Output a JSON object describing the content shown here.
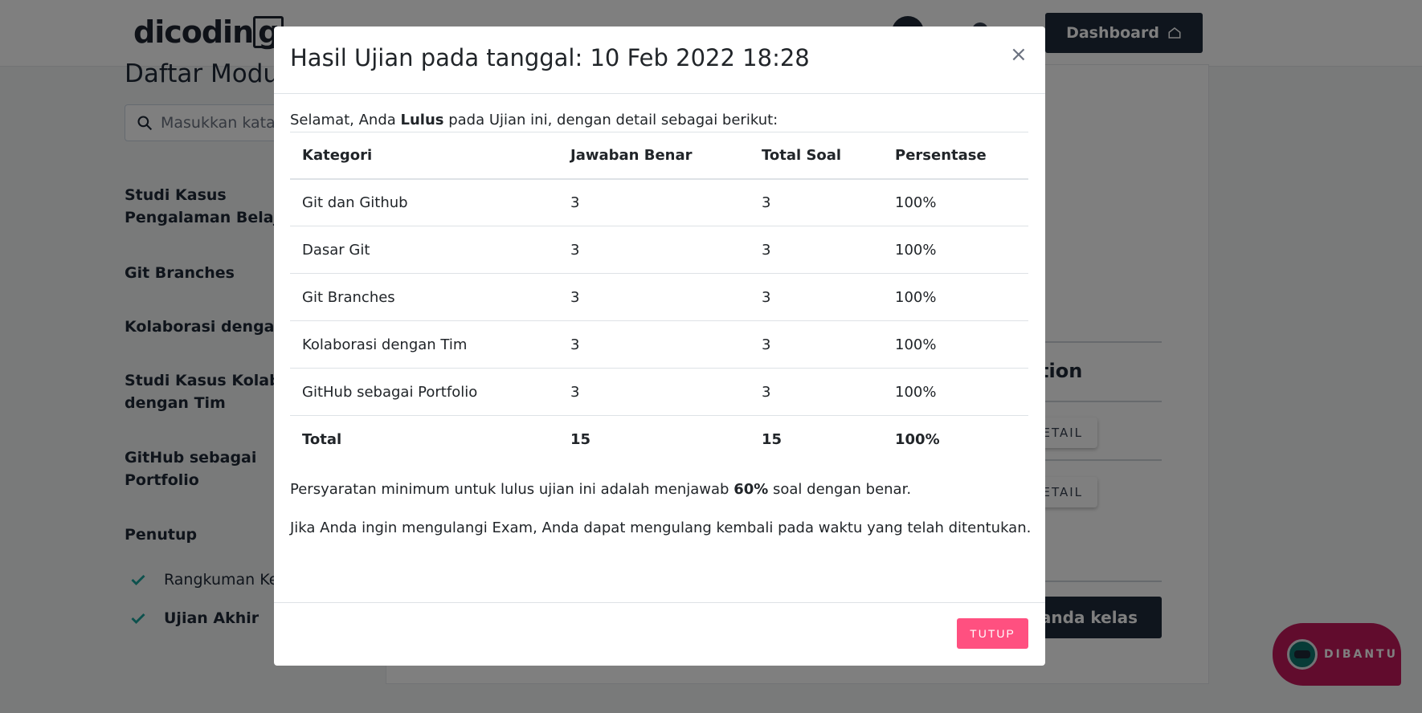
{
  "header": {
    "logo_prefix": "dicodin",
    "logo_boxed": "g",
    "dashboard_label": "Dashboard"
  },
  "sidebar": {
    "title": "Daftar Modul",
    "search_placeholder": "Masukkan kata",
    "items": [
      {
        "label": "Studi Kasus",
        "label2": "Pengalaman Belajar"
      },
      {
        "label": "Git Branches"
      },
      {
        "label": "Kolaborasi dengan T"
      },
      {
        "label": "Studi Kasus Kolabor",
        "label2": "dengan Tim"
      },
      {
        "label": "GitHub sebagai",
        "label2": "Portfolio"
      },
      {
        "label": "Penutup"
      }
    ],
    "sub_items": [
      {
        "label": "Rangkuman Ke"
      },
      {
        "label": "Ujian Akhir"
      }
    ]
  },
  "background": {
    "section_heading": "tion",
    "detail_label": "ETAIL",
    "beranda_label": "eranda kelas"
  },
  "chat_widget": {
    "label": "DIBANTU"
  },
  "modal": {
    "title": "Hasil Ujian pada tanggal: 10 Feb 2022 18:28",
    "close_symbol": "×",
    "intro_prefix": "Selamat, Anda ",
    "intro_bold": "Lulus",
    "intro_suffix": " pada Ujian ini, dengan detail sebagai berikut:",
    "table": {
      "headers": [
        "Kategori",
        "Jawaban Benar",
        "Total Soal",
        "Persentase"
      ],
      "rows": [
        [
          "Git dan Github",
          "3",
          "3",
          "100%"
        ],
        [
          "Dasar Git",
          "3",
          "3",
          "100%"
        ],
        [
          "Git Branches",
          "3",
          "3",
          "100%"
        ],
        [
          "Kolaborasi dengan Tim",
          "3",
          "3",
          "100%"
        ],
        [
          "GitHub sebagai Portfolio",
          "3",
          "3",
          "100%"
        ]
      ],
      "total": [
        "Total",
        "15",
        "15",
        "100%"
      ]
    },
    "requirement_prefix": "Persyaratan minimum untuk lulus ujian ini adalah menjawab ",
    "requirement_bold": "60%",
    "requirement_suffix": " soal dengan benar.",
    "retry_text": "Jika Anda ingin mengulangi Exam, Anda dapat mengulang kembali pada waktu yang telah ditentukan.",
    "close_button_label": "TUTUP"
  },
  "colors": {
    "accent_pink": "#ff5080",
    "dark_navy": "#1e2a3a",
    "check_teal": "#1aa39a",
    "chat_magenta": "#c2185b"
  },
  "icons": [
    "home-icon",
    "search-icon",
    "check-icon",
    "close-icon",
    "bell-icon",
    "bot-icon"
  ]
}
